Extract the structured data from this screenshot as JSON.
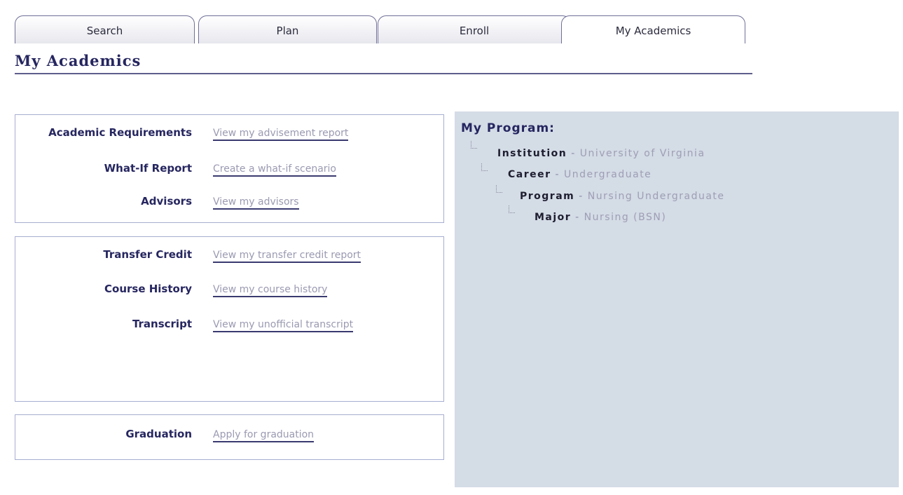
{
  "tabs": [
    {
      "label": "Search"
    },
    {
      "label": "Plan"
    },
    {
      "label": "Enroll"
    },
    {
      "label": "My Academics"
    }
  ],
  "page": {
    "title": "My Academics"
  },
  "sections": {
    "requirements": [
      {
        "label": "Academic Requirements",
        "link": "View my advisement report"
      },
      {
        "label": "What-If Report",
        "link": "Create a what-if scenario"
      },
      {
        "label": "Advisors",
        "link": "View my advisors"
      }
    ],
    "records": [
      {
        "label": "Transfer Credit",
        "link": "View my transfer credit report"
      },
      {
        "label": "Course History",
        "link": "View my course history"
      },
      {
        "label": "Transcript",
        "link": "View my unofficial transcript"
      }
    ],
    "graduation": [
      {
        "label": "Graduation",
        "link": "Apply for graduation"
      }
    ]
  },
  "program": {
    "heading": "My Program:",
    "separator": "-",
    "tree": [
      {
        "key": "Institution",
        "value": "University of Virginia"
      },
      {
        "key": "Career",
        "value": "Undergraduate"
      },
      {
        "key": "Program",
        "value": "Nursing Undergraduate"
      },
      {
        "key": "Major",
        "value": "Nursing (BSN)"
      }
    ]
  }
}
